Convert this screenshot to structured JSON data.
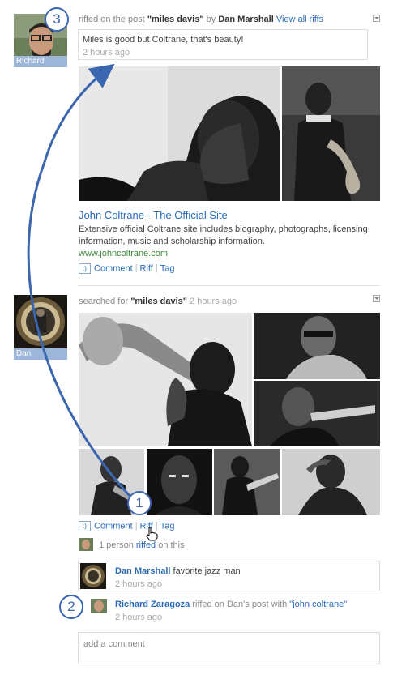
{
  "post1": {
    "user": "Richard",
    "action": "riffed on the post",
    "post_title": "\"miles davis\"",
    "by": "by",
    "author": "Dan Marshall",
    "view_all": "View all riffs",
    "comment_text": "Miles is good but Coltrane, that's beauty!",
    "comment_time": "2 hours ago",
    "link_title": "John Coltrane - The Official Site",
    "link_desc": "Extensive official Coltrane site includes biography, photographs, licensing information, music and scholarship information.",
    "link_url": "www.johncoltrane.com",
    "actions": {
      "smile": ":)",
      "comment": "Comment",
      "riff": "Riff",
      "tag": "Tag"
    }
  },
  "post2": {
    "user": "Dan",
    "action": "searched for",
    "query": "\"miles davis\"",
    "time": "2 hours ago",
    "actions": {
      "smile": ":)",
      "comment": "Comment",
      "riff": "Riff",
      "tag": "Tag"
    },
    "riff_summary": {
      "pre": "1 person",
      "link": "riffed",
      "post": "on this"
    },
    "comments": [
      {
        "name": "Dan Marshall",
        "text": "favorite jazz man",
        "time": "2 hours ago"
      },
      {
        "name": "Richard Zaragoza",
        "text": "riffed on Dan's post with",
        "quote": "\"john coltrane\"",
        "time": "2 hours ago"
      }
    ],
    "add_comment_placeholder": "add a comment"
  },
  "markers": {
    "m1": "1",
    "m2": "2",
    "m3": "3"
  },
  "colors": {
    "link": "#2a6bb8",
    "marker": "#3b66b0",
    "name_bar": "#9bb6d9"
  }
}
